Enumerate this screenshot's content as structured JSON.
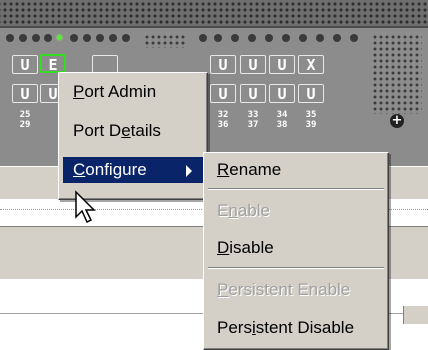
{
  "ports": {
    "top_row": [
      "U",
      "E",
      "",
      "U",
      "U",
      "U",
      "X"
    ],
    "bottom_row": [
      "U",
      "U",
      "U",
      "U",
      "U",
      "U"
    ],
    "numbers_left": [
      {
        "top": "25",
        "bottom": "29"
      }
    ],
    "numbers_right": [
      {
        "top": "32",
        "bottom": "36"
      },
      {
        "top": "33",
        "bottom": "37"
      },
      {
        "top": "34",
        "bottom": "38"
      },
      {
        "top": "35",
        "bottom": "39"
      }
    ],
    "expand_symbol": "+",
    "selected_port_color": "#33dd22",
    "active_led_color": "#55ee33"
  },
  "context_menu": {
    "items": [
      {
        "pre": "",
        "mnemonic": "P",
        "post": "ort Admin"
      },
      {
        "pre": "Port D",
        "mnemonic": "e",
        "post": "tails"
      },
      {
        "pre": "",
        "mnemonic": "C",
        "post": "onfigure"
      }
    ],
    "highlighted_item": "Configure",
    "highlight_color": "#0a246a"
  },
  "submenu": {
    "items": [
      {
        "pre": "",
        "mnemonic": "R",
        "post": "ename",
        "enabled": true
      },
      {
        "pre": "E",
        "mnemonic": "n",
        "post": "able",
        "enabled": false
      },
      {
        "pre": "",
        "mnemonic": "D",
        "post": "isable",
        "enabled": true
      },
      {
        "pre": "",
        "mnemonic": "P",
        "post": "ersistent Enable",
        "enabled": false
      },
      {
        "pre": "Pers",
        "mnemonic": "i",
        "post": "stent Disable",
        "enabled": true
      }
    ]
  },
  "icons": {
    "submenu_arrow": "triangle-right-icon",
    "cursor": "mouse-pointer-icon",
    "expand": "plus-circle-icon"
  }
}
